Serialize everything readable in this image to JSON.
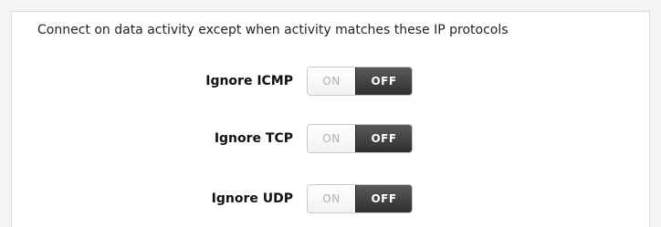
{
  "section": {
    "heading": "Connect on data activity except when activity matches these IP protocols"
  },
  "settings": [
    {
      "label": "Ignore ICMP",
      "on_label": "ON",
      "off_label": "OFF",
      "state": "OFF"
    },
    {
      "label": "Ignore TCP",
      "on_label": "ON",
      "off_label": "OFF",
      "state": "OFF"
    },
    {
      "label": "Ignore UDP",
      "on_label": "ON",
      "off_label": "OFF",
      "state": "OFF"
    }
  ],
  "colors": {
    "off_active_bg": "#3a3a3a",
    "on_inactive_text": "#b0b0b0",
    "panel_bg": "#ffffff",
    "page_bg": "#f4f4f4"
  }
}
